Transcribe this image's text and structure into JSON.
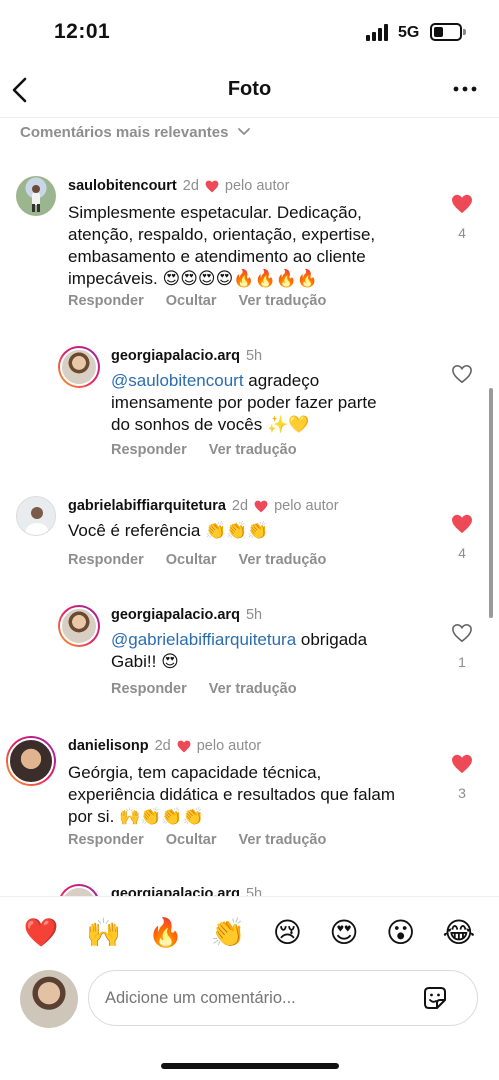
{
  "status_bar": {
    "time": "12:01",
    "network": "5G"
  },
  "nav": {
    "title": "Foto"
  },
  "sort": {
    "label": "Comentários mais relevantes"
  },
  "comments": [
    {
      "username": "saulobitencourt",
      "time": "2d",
      "author_badge": "pelo autor",
      "text_lines": [
        "Simplesmente espetacular. Dedicação,",
        "atenção, respaldo, orientação, expertise,",
        "embasamento e atendimento ao cliente",
        "impecáveis. 😍😍😍😍🔥🔥🔥🔥"
      ],
      "actions": [
        "Responder",
        "Ocultar",
        "Ver tradução"
      ],
      "likes": "4"
    },
    {
      "username": "georgiapalacio.arq",
      "time": "5h",
      "mention": "@saulobitencourt",
      "text_lines": [
        " agradeço",
        "imensamente por poder fazer parte",
        "do sonhos de vocês ✨💛"
      ],
      "actions": [
        "Responder",
        "Ver tradução"
      ]
    },
    {
      "username": "gabrielabiffiarquitetura",
      "time": "2d",
      "author_badge": "pelo autor",
      "text_lines": [
        "Você é referência 👏👏👏"
      ],
      "actions": [
        "Responder",
        "Ocultar",
        "Ver tradução"
      ],
      "likes": "4"
    },
    {
      "username": "georgiapalacio.arq",
      "time": "5h",
      "mention": "@gabrielabiffiarquitetura",
      "text_lines": [
        " obrigada",
        "Gabi!! 😍"
      ],
      "actions": [
        "Responder",
        "Ver tradução"
      ],
      "likes": "1"
    },
    {
      "username": "danielisonp",
      "time": "2d",
      "author_badge": "pelo autor",
      "text_lines": [
        "Geórgia, tem capacidade técnica,",
        "experiência didática e resultados que falam",
        "por si. 🙌👏👏👏"
      ],
      "actions": [
        "Responder",
        "Ocultar",
        "Ver tradução"
      ],
      "likes": "3"
    }
  ],
  "partial": {
    "username": "georgiapalacio.arq",
    "time": "5h"
  },
  "reactions": [
    "❤️",
    "🙌",
    "🔥",
    "👏",
    "😢",
    "😍",
    "😮",
    "😂"
  ],
  "composer": {
    "placeholder": "Adicione um comentário..."
  },
  "colors": {
    "like_red": "#ed4956",
    "mention_blue": "#2b6cb0",
    "muted": "#8e8e8e"
  }
}
